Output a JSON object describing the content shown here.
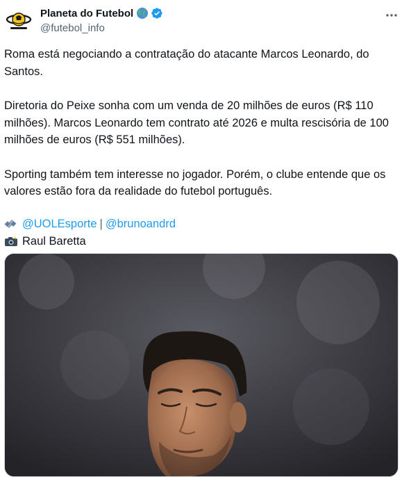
{
  "account": {
    "display_name": "Planeta do Futebol",
    "handle": "@futebol_info",
    "name_emoji": "globe-icon",
    "verified": true,
    "verified_color": "#1d9bf0"
  },
  "tweet": {
    "paragraphs": [
      "Roma está negociando a contratação do atacante Marcos Leonardo, do Santos.",
      "Diretoria do Peixe sonha com um venda de 20 milhões de euros (R$ 110 milhões). Marcos Leonardo tem contrato até 2026 e multa rescisória de 100 milhões de euros (R$ 551 milhões).",
      "Sporting também tem interesse no jogador. Porém, o clube entende que os valores estão fora da realidade do futebol português."
    ],
    "source_mention_1": "@UOLEsporte",
    "separator": "|",
    "source_mention_2": "@brunoandrd",
    "photo_credit": "Raul Baretta"
  },
  "icons": {
    "more": "more-horizontal-icon",
    "source": "satellite-icon",
    "camera": "camera-flash-icon"
  },
  "colors": {
    "link": "#1d9bf0",
    "secondary_text": "#536471",
    "text": "#0f1419"
  }
}
